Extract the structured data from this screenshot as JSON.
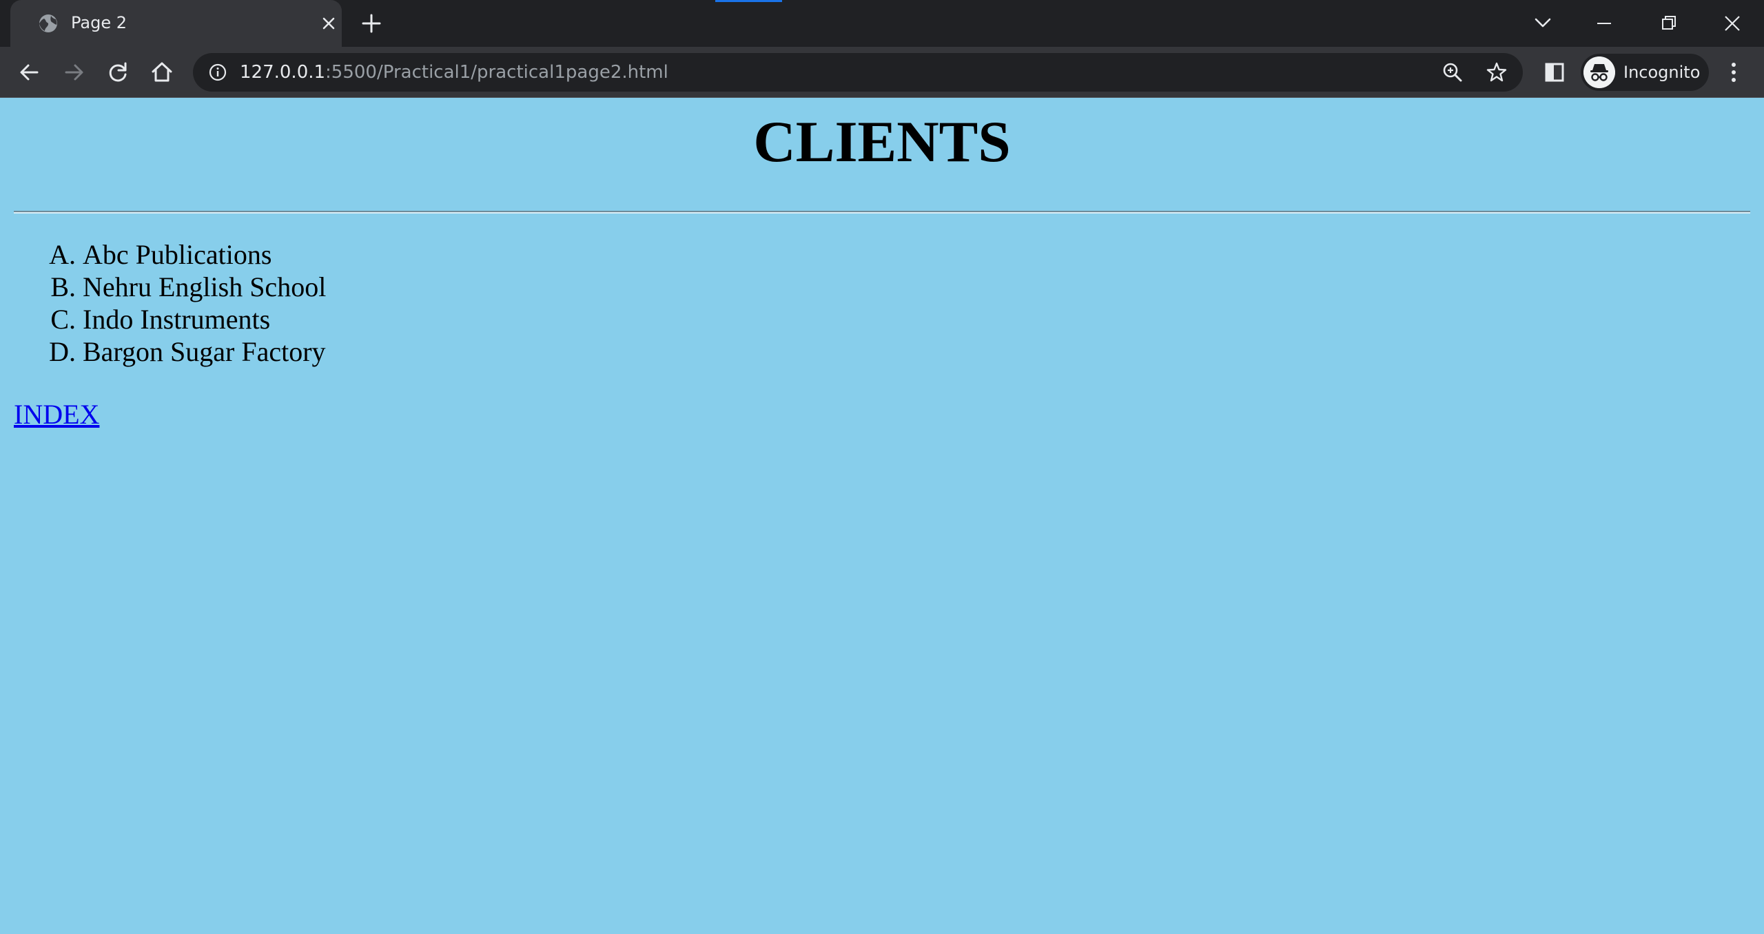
{
  "browser": {
    "tab": {
      "title": "Page 2"
    },
    "address_bar": {
      "host": "127.0.0.1",
      "path": ":5500/Practical1/practical1page2.html"
    },
    "profile": {
      "label": "Incognito"
    }
  },
  "page": {
    "background_color": "#87ceeb",
    "heading": "CLIENTS",
    "clients": [
      {
        "marker": "A.",
        "name": "Abc Publications"
      },
      {
        "marker": "B.",
        "name": "Nehru English School"
      },
      {
        "marker": "C.",
        "name": "Indo Instruments"
      },
      {
        "marker": "D.",
        "name": "Bargon Sugar Factory"
      }
    ],
    "index_link": {
      "label": "INDEX",
      "color": "#0000ee"
    }
  },
  "icons": {
    "favicon": "globe-icon",
    "tab_close": "close-icon",
    "new_tab": "plus-icon",
    "tab_search": "chevron-down-icon",
    "minimize": "minimize-icon",
    "restore": "restore-icon",
    "close_window": "close-icon",
    "back": "arrow-left-icon",
    "forward": "arrow-right-icon",
    "reload": "reload-icon",
    "home": "home-icon",
    "site_info": "info-icon",
    "zoom": "zoom-icon",
    "bookmark": "star-icon",
    "side_panel": "side-panel-icon",
    "incognito": "incognito-icon",
    "menu": "kebab-menu-icon"
  }
}
